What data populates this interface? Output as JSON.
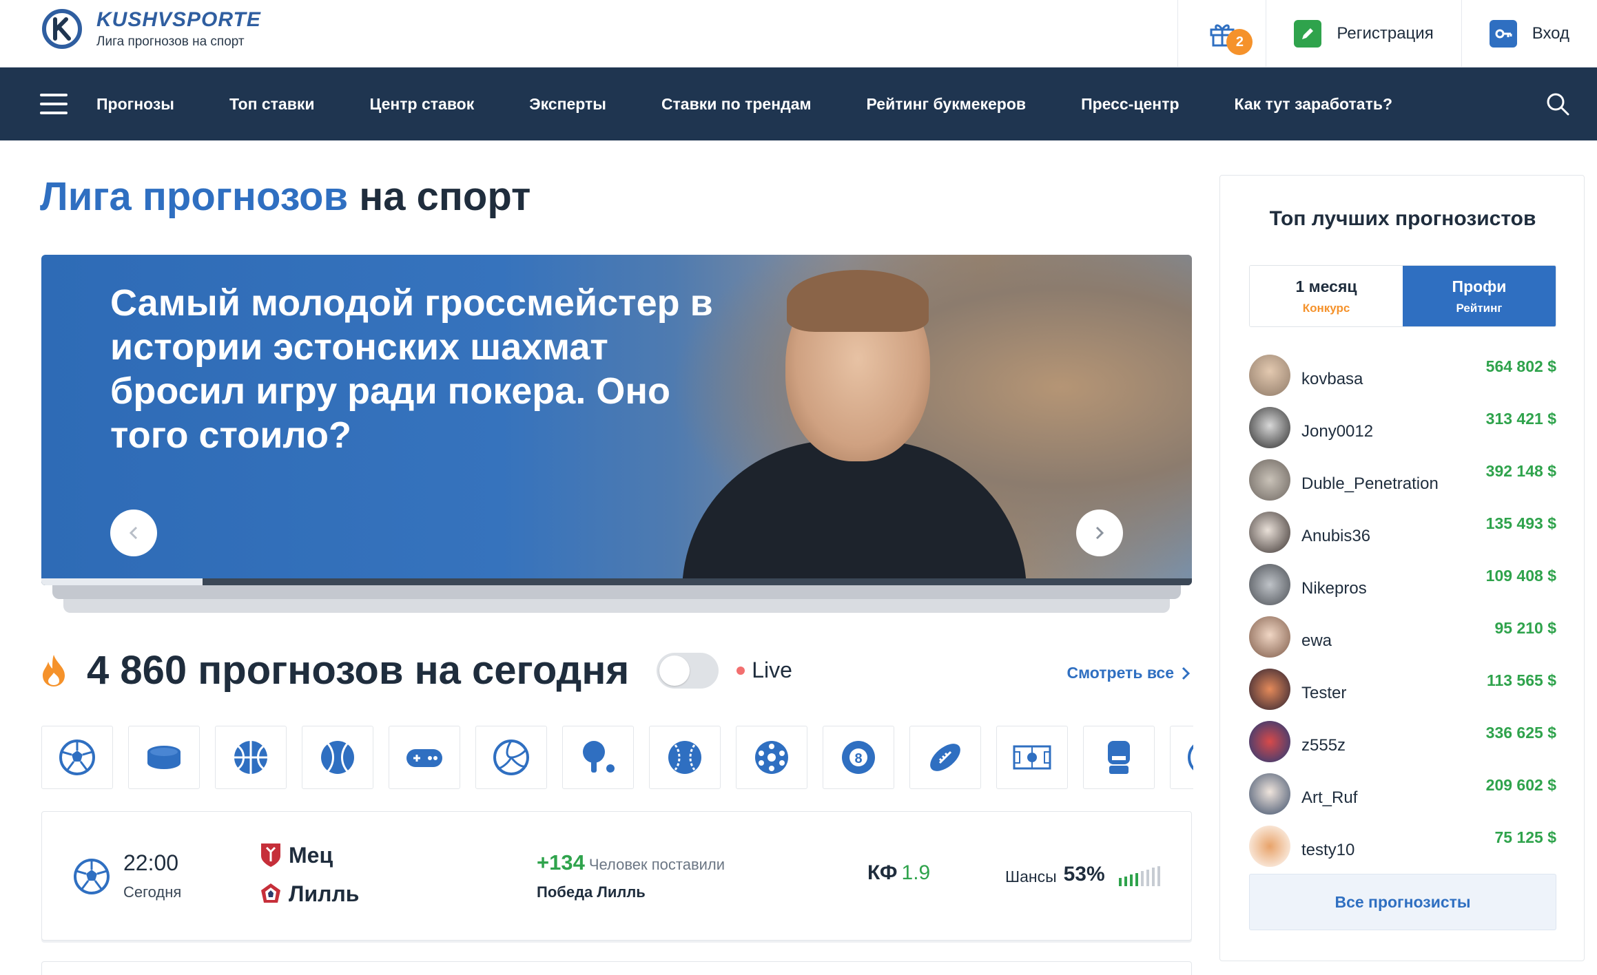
{
  "header": {
    "logo_title": "KUSHVSPORTE",
    "logo_subtitle": "Лига прогнозов на спорт",
    "gift_badge": "2",
    "register_label": "Регистрация",
    "login_label": "Вход"
  },
  "nav": {
    "items": [
      {
        "label": "Прогнозы"
      },
      {
        "label": "Топ ставки"
      },
      {
        "label": "Центр ставок"
      },
      {
        "label": "Эксперты"
      },
      {
        "label": "Ставки по трендам"
      },
      {
        "label": "Рейтинг букмекеров"
      },
      {
        "label": "Пресс-центр"
      },
      {
        "label": "Как тут заработать?"
      }
    ]
  },
  "main": {
    "title_blue": "Лига прогнозов",
    "title_rest": " на спорт",
    "banner": {
      "headline": "Самый молодой гроссмейстер в истории эстонских шахмат бросил игру ради покера. Оно того стоило?",
      "progress_fraction": 0.14
    },
    "forecasts": {
      "title": "4 860 прогнозов на сегодня",
      "live_label": "Live",
      "see_all": "Смотреть все"
    },
    "sports": [
      {
        "icon": "soccer-icon"
      },
      {
        "icon": "hockey-puck-icon"
      },
      {
        "icon": "basketball-icon"
      },
      {
        "icon": "tennis-icon"
      },
      {
        "icon": "gamepad-icon"
      },
      {
        "icon": "volleyball-icon"
      },
      {
        "icon": "table-tennis-icon"
      },
      {
        "icon": "baseball-icon"
      },
      {
        "icon": "futsal-icon"
      },
      {
        "icon": "billiards-icon"
      },
      {
        "icon": "american-football-icon"
      },
      {
        "icon": "table-soccer-icon"
      },
      {
        "icon": "boxing-glove-icon"
      },
      {
        "icon": "more-sport-icon"
      }
    ],
    "match": {
      "time": "22:00",
      "day": "Сегодня",
      "team1": "Мец",
      "team2": "Лилль",
      "bets_count": "+134",
      "bets_label": "Человек поставили",
      "pick": "Победа Лилль",
      "kf_label": "КФ",
      "kf_value": "1.9",
      "chance_label": "Шансы",
      "chance_value": "53%",
      "chance_fraction": 0.53
    }
  },
  "sidebar": {
    "title": "Топ лучших прогнозистов",
    "tabs": [
      {
        "label": "1 месяц",
        "sub": "Конкурс",
        "active": false
      },
      {
        "label": "Профи",
        "sub": "Рейтинг",
        "active": true
      }
    ],
    "forecasters": [
      {
        "name": "kovbasa",
        "amount": "564 802 $"
      },
      {
        "name": "Jony0012",
        "amount": "313 421 $"
      },
      {
        "name": "Duble_Penetration",
        "amount": "392 148 $"
      },
      {
        "name": "Anubis36",
        "amount": "135 493 $"
      },
      {
        "name": "Nikepros",
        "amount": "109 408 $"
      },
      {
        "name": "ewa",
        "amount": "95 210 $"
      },
      {
        "name": "Tester",
        "amount": "113 565 $"
      },
      {
        "name": "z555z",
        "amount": "336 625 $"
      },
      {
        "name": "Art_Ruf",
        "amount": "209 602 $"
      },
      {
        "name": "testy10",
        "amount": "75 125 $"
      }
    ],
    "all_button": "Все прогнозисты"
  },
  "colors": {
    "brand_blue": "#2f6fc1",
    "nav_bg": "#1f3550",
    "accent_green": "#2fa34c",
    "accent_orange": "#f5922b"
  }
}
